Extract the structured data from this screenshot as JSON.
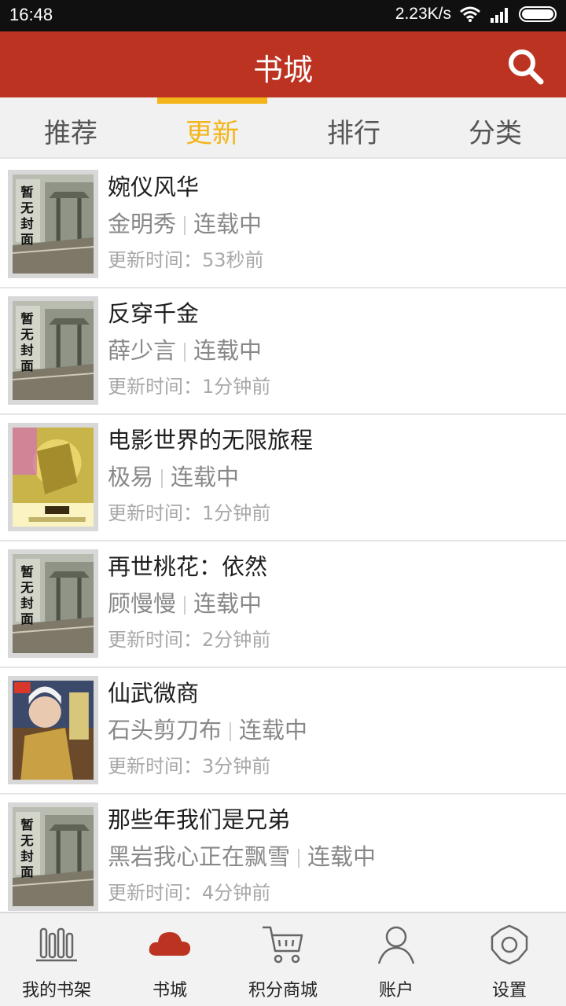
{
  "status_bar": {
    "time": "16:48",
    "network_speed": "2.23K/s"
  },
  "header": {
    "title": "书城"
  },
  "tabs": [
    {
      "label": "推荐",
      "active": false
    },
    {
      "label": "更新",
      "active": true
    },
    {
      "label": "排行",
      "active": false
    },
    {
      "label": "分类",
      "active": false
    }
  ],
  "books": [
    {
      "title": "婉仪风华",
      "author": "金明秀",
      "status": "连载中",
      "updated": "更新时间：53秒前",
      "cover": "placeholder"
    },
    {
      "title": "反穿千金",
      "author": "薛少言",
      "status": "连载中",
      "updated": "更新时间：1分钟前",
      "cover": "placeholder"
    },
    {
      "title": "电影世界的无限旅程",
      "author": "极易",
      "status": "连载中",
      "updated": "更新时间：1分钟前",
      "cover": "yellow-art"
    },
    {
      "title": "再世桃花：依然",
      "author": "顾慢慢",
      "status": "连载中",
      "updated": "更新时间：2分钟前",
      "cover": "placeholder"
    },
    {
      "title": "仙武微商",
      "author": "石头剪刀布",
      "status": "连载中",
      "updated": "更新时间：3分钟前",
      "cover": "warrior-art"
    },
    {
      "title": "那些年我们是兄弟",
      "author": "黑岩我心正在飘雪",
      "status": "连载中",
      "updated": "更新时间：4分钟前",
      "cover": "placeholder"
    }
  ],
  "bottom_nav": [
    {
      "label": "我的书架",
      "icon": "bookshelf-icon",
      "active": false
    },
    {
      "label": "书城",
      "icon": "cloud-icon",
      "active": true
    },
    {
      "label": "积分商城",
      "icon": "cart-icon",
      "active": false
    },
    {
      "label": "账户",
      "icon": "user-icon",
      "active": false
    },
    {
      "label": "设置",
      "icon": "gear-icon",
      "active": false
    }
  ],
  "colors": {
    "primary": "#bd3322",
    "accent": "#f3b51a",
    "tab_bg": "#f1f1f1"
  }
}
